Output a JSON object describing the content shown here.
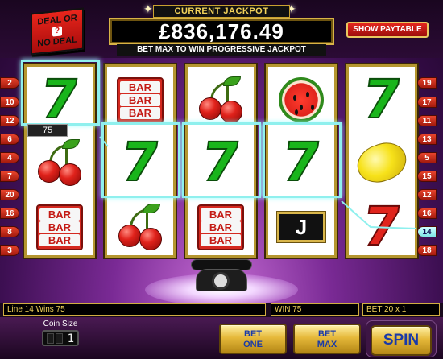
{
  "logo": {
    "line1": "DEAL OR",
    "q": "?",
    "line2": "NO DEAL"
  },
  "jackpot": {
    "label": "CURRENT JACKPOT",
    "amount": "£836,176.49",
    "subtitle": "BET MAX TO WIN PROGRESSIVE JACKPOT"
  },
  "paytable_label": "SHOW PAYTABLE",
  "reels": [
    [
      "seven-green",
      "cherry",
      "bar-triple"
    ],
    [
      "bar-triple",
      "seven-green",
      "cherry"
    ],
    [
      "cherry",
      "seven-green",
      "bar-triple"
    ],
    [
      "watermelon",
      "seven-green",
      "jack"
    ],
    [
      "seven-green",
      "lemon",
      "seven-red"
    ]
  ],
  "bar_text": "BAR",
  "jack_text": "J",
  "left_lines": [
    "2",
    "10",
    "12",
    "6",
    "4",
    "7",
    "20",
    "16",
    "8",
    "3"
  ],
  "right_lines": [
    "19",
    "17",
    "11",
    "13",
    "5",
    "15",
    "12",
    "16",
    "14",
    "18"
  ],
  "active_line": "14",
  "win_bubble": "75",
  "info": {
    "line_win": "Line 14 Wins 75",
    "win": "WIN  75",
    "bet": "BET   20 x 1"
  },
  "controls": {
    "coin_size_label": "Coin Size",
    "coin_value": "1",
    "bet_one_label": "BET ONE",
    "bet_max_label": "BET MAX",
    "spin_label": "SPIN"
  }
}
